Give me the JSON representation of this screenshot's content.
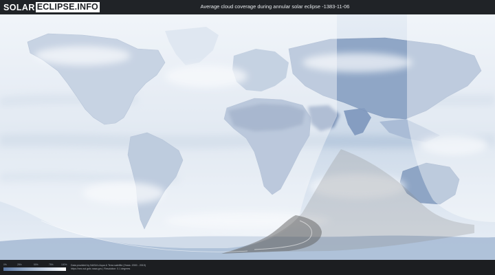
{
  "header": {
    "logo_solar": "SOLAR",
    "logo_eclipse": "ECLIPSE.INFO",
    "title": "Average cloud coverage during annular solar eclipse -1383-11-06"
  },
  "legend": {
    "ticks": [
      "0%",
      "25%",
      "50%",
      "75%",
      "100%"
    ],
    "colors": {
      "low": "#5b78a4",
      "mid": "#c8d5e6",
      "high": "#ffffff"
    }
  },
  "attribution": {
    "line1": "Data provided by NASA's Aqua & Terra satellite (Years: 2000 - 2019)",
    "line2": "https://neo.sci.gsfc.nasa.gov | Resolution: 0.1 degrees"
  },
  "colors": {
    "background": "#1c1e21",
    "ocean_cloud": "#dfe8f2",
    "land_clear": "#7b93b7",
    "eclipse_shadow": "#6e6e6e"
  }
}
